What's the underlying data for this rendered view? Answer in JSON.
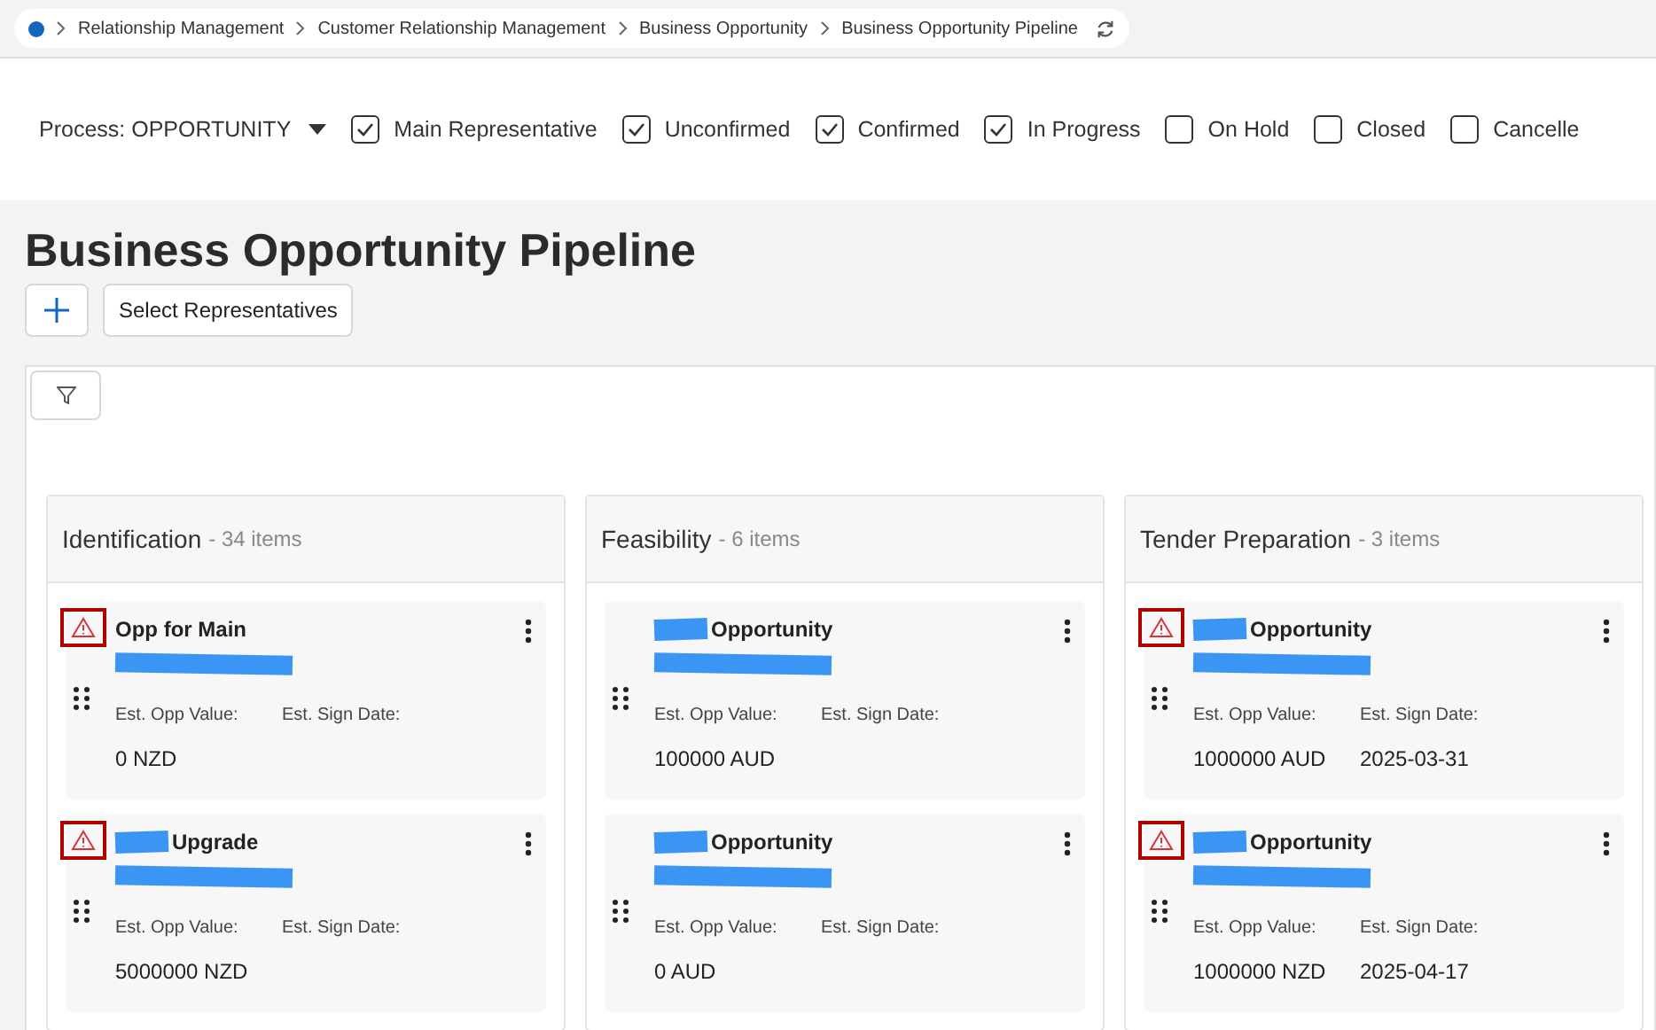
{
  "breadcrumb": [
    "Relationship Management",
    "Customer Relationship Management",
    "Business Opportunity",
    "Business Opportunity Pipeline"
  ],
  "process": {
    "label": "Process: OPPORTUNITY"
  },
  "filters": [
    {
      "label": "Main Representative",
      "checked": true
    },
    {
      "label": "Unconfirmed",
      "checked": true
    },
    {
      "label": "Confirmed",
      "checked": true
    },
    {
      "label": "In Progress",
      "checked": true
    },
    {
      "label": "On Hold",
      "checked": false
    },
    {
      "label": "Closed",
      "checked": false
    },
    {
      "label": "Cancelle",
      "checked": false
    }
  ],
  "page_title": "Business Opportunity Pipeline",
  "select_button": "Select Representatives",
  "columns": [
    {
      "title": "Identification",
      "count": "- 34 items",
      "cards": [
        {
          "title": "Opp for Main",
          "title_redacted": false,
          "warning": true,
          "value_label": "Est. Opp Value:",
          "date_label": "Est. Sign Date:",
          "value": "0 NZD"
        },
        {
          "title": "Upgrade",
          "title_redacted": true,
          "warning": true,
          "value_label": "Est. Opp Value:",
          "date_label": "Est. Sign Date:",
          "value": "5000000 NZD"
        }
      ]
    },
    {
      "title": "Feasibility",
      "count": "- 6 items",
      "cards": [
        {
          "title": "Opportunity",
          "title_redacted": true,
          "warning": false,
          "value_label": "Est. Opp Value:",
          "date_label": "Est. Sign Date:",
          "value": "100000 AUD"
        },
        {
          "title": "Opportunity",
          "title_redacted": true,
          "warning": false,
          "value_label": "Est. Opp Value:",
          "date_label": "Est. Sign Date:",
          "value": "0 AUD"
        }
      ]
    },
    {
      "title": "Tender Preparation",
      "count": "- 3 items",
      "cards": [
        {
          "title": "Opportunity",
          "title_redacted": true,
          "warning": true,
          "value_label": "Est. Opp Value:",
          "date_label": "Est. Sign Date:",
          "value": "1000000 AUD",
          "date": "2025-03-31"
        },
        {
          "title": "Opportunity",
          "title_redacted": true,
          "warning": true,
          "value_label": "Est. Opp Value:",
          "date_label": "Est. Sign Date:",
          "value": "1000000 NZD",
          "date": "2025-04-17"
        }
      ]
    }
  ]
}
